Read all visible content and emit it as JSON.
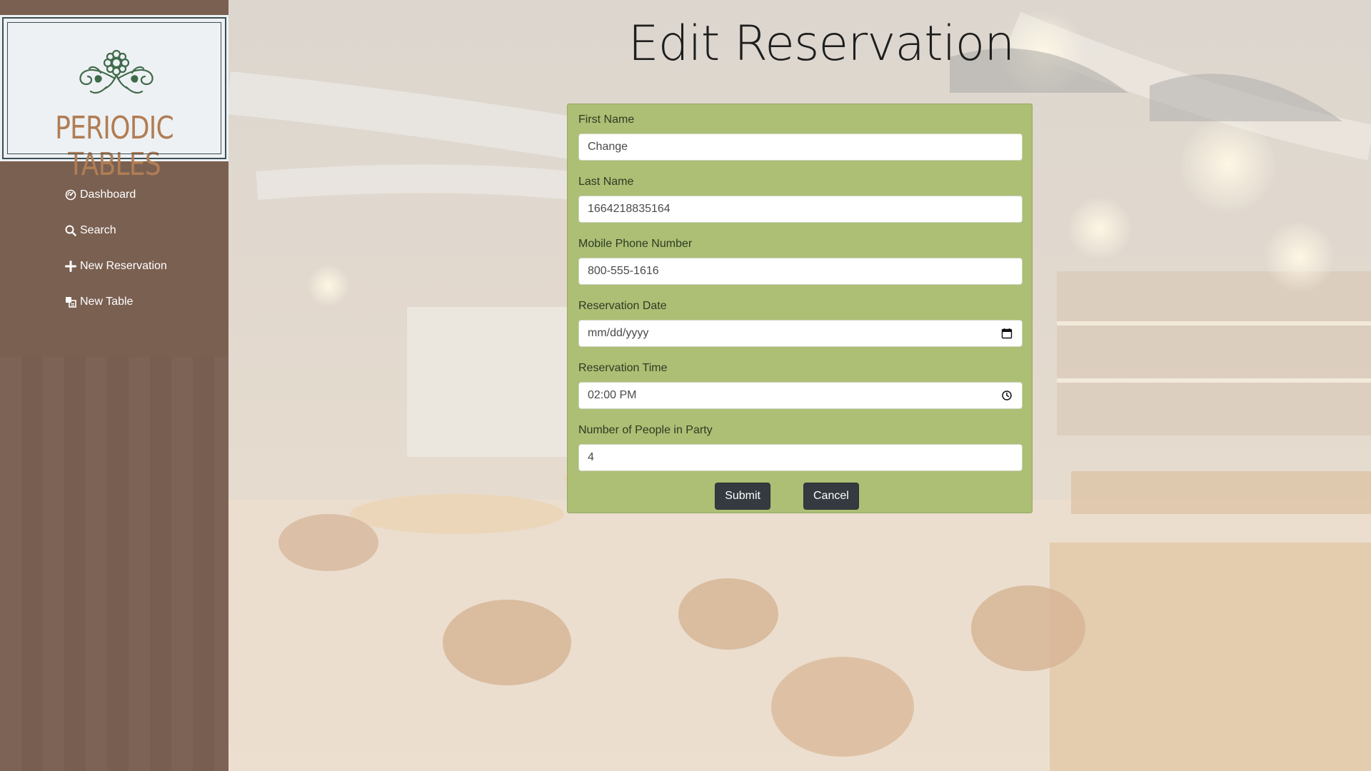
{
  "brand": {
    "logo_text": "PERIODIC TABLES"
  },
  "sidebar": {
    "items": [
      {
        "label": "Dashboard",
        "icon": "dashboard-icon"
      },
      {
        "label": "Search",
        "icon": "search-icon"
      },
      {
        "label": "New Reservation",
        "icon": "plus-icon"
      },
      {
        "label": "New Table",
        "icon": "new-table-icon"
      }
    ]
  },
  "page": {
    "title": "Edit Reservation"
  },
  "form": {
    "fields": [
      {
        "label": "First Name",
        "value": "Change"
      },
      {
        "label": "Last Name",
        "value": "1664218835164"
      },
      {
        "label": "Mobile Phone Number",
        "value": "800-555-1616"
      },
      {
        "label": "Reservation Date",
        "value": "",
        "placeholder": "mm/dd/yyyy",
        "icon": "calendar-icon"
      },
      {
        "label": "Reservation Time",
        "value": "02:00 PM",
        "icon": "clock-icon"
      },
      {
        "label": "Number of People in Party",
        "value": "4"
      }
    ],
    "submit_label": "Submit",
    "cancel_label": "Cancel"
  },
  "colors": {
    "sidebar_bg": "#7a6051",
    "form_bg": "#acbf74",
    "button_bg": "#343a40",
    "logo_text": "#b07d55",
    "logo_ornament": "#3f6a4a"
  }
}
